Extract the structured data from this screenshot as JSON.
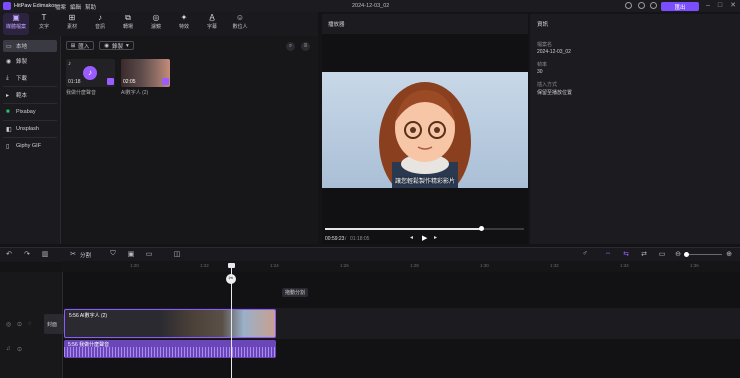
{
  "app": {
    "title": "HitPaw Edimakor",
    "menus": [
      "檔案",
      "編輯",
      "幫助"
    ],
    "project_title": "2024-12-03_02",
    "export_label": "匯出"
  },
  "tools": [
    {
      "label": "媒體檔案",
      "icon": "media-icon"
    },
    {
      "label": "文字",
      "icon": "text-icon"
    },
    {
      "label": "素材",
      "icon": "stickers-icon"
    },
    {
      "label": "音訊",
      "icon": "audio-icon"
    },
    {
      "label": "轉場",
      "icon": "transition-icon"
    },
    {
      "label": "濾鏡",
      "icon": "filter-icon"
    },
    {
      "label": "特效",
      "icon": "effects-icon"
    },
    {
      "label": "字幕",
      "icon": "subtitle-icon"
    },
    {
      "label": "數位人",
      "icon": "avatar-icon"
    }
  ],
  "sidebar": [
    {
      "label": "本地",
      "icon": "folder-icon"
    },
    {
      "label": "錄製",
      "icon": "record-icon"
    },
    {
      "label": "下載",
      "icon": "download-icon"
    },
    {
      "label": "範本",
      "icon": "template-icon"
    },
    {
      "label": "Pixabay",
      "icon": "pixabay-icon"
    },
    {
      "label": "Unsplash",
      "icon": "unsplash-icon"
    },
    {
      "label": "Giphy GIF",
      "icon": "giphy-icon"
    }
  ],
  "media": {
    "import_label": "匯入",
    "record_label": "錄製",
    "items": [
      {
        "duration": "01:18",
        "name": "我做什麼聲音"
      },
      {
        "duration": "02:05",
        "name": "AI數字人 (2)"
      }
    ]
  },
  "preview": {
    "header": "播放器",
    "subtitle": "讓您輕鬆製作精彩影片",
    "current_time": "00:59:23",
    "total_time": "01:18:05"
  },
  "info": {
    "header": "資訊",
    "fields": [
      {
        "label": "檔案名",
        "value": "2024-12-03_02"
      },
      {
        "label": "幀率",
        "value": "30"
      },
      {
        "label": "插入方式",
        "value": "保留至播放位置"
      }
    ]
  },
  "timeline": {
    "split_label": "分割",
    "tooltip": "拖動分割",
    "track_label": "封面",
    "video_clip_label": "5:56 AI數字人 (2)",
    "audio_clip_label": "5:56 我做什麼聲音",
    "ruler": [
      "1:20",
      "1:22",
      "1:24",
      "1:26",
      "1:28",
      "1:30",
      "1:32",
      "1:34",
      "1:36",
      "1:38"
    ]
  }
}
